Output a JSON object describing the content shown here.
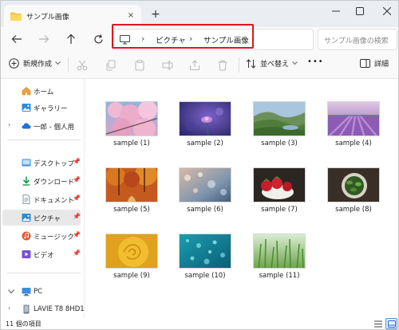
{
  "tab": {
    "title": "サンプル画像",
    "close": "×",
    "add": "+"
  },
  "window_controls": {
    "minimize": "–",
    "maximize": "☐",
    "close": "✕"
  },
  "nav": {
    "back": "←",
    "forward": "→",
    "up": "↑",
    "refresh": "↻"
  },
  "breadcrumb": {
    "sep1": "›",
    "sep2": "›",
    "items": [
      "ピクチャ",
      "サンプル画像"
    ]
  },
  "search": {
    "placeholder": "サンプル画像の検索"
  },
  "toolbar": {
    "new_label": "新規作成",
    "sort_label": "並べ替え",
    "more": "•••",
    "details_label": "詳細"
  },
  "sidebar": {
    "items": [
      {
        "label": "ホーム"
      },
      {
        "label": "ギャラリー"
      },
      {
        "label": "一郎 - 個人用"
      },
      {
        "label": "デスクトップ"
      },
      {
        "label": "ダウンロード"
      },
      {
        "label": "ドキュメント"
      },
      {
        "label": "ピクチャ"
      },
      {
        "label": "ミュージック"
      },
      {
        "label": "ビデオ"
      },
      {
        "label": "PC"
      },
      {
        "label": "LAVIE T8 8HD1"
      }
    ]
  },
  "files": [
    {
      "name": "sample (1)"
    },
    {
      "name": "sample (2)"
    },
    {
      "name": "sample (3)"
    },
    {
      "name": "sample (4)"
    },
    {
      "name": "sample (5)"
    },
    {
      "name": "sample (6)"
    },
    {
      "name": "sample (7)"
    },
    {
      "name": "sample (8)"
    },
    {
      "name": "sample (9)"
    },
    {
      "name": "sample (10)"
    },
    {
      "name": "sample (11)"
    }
  ],
  "status": {
    "item_count": "11 個の項目"
  },
  "colors": {
    "highlight": "#e1141e",
    "accent": "#0067c0",
    "selected": "#e8e8e8"
  }
}
